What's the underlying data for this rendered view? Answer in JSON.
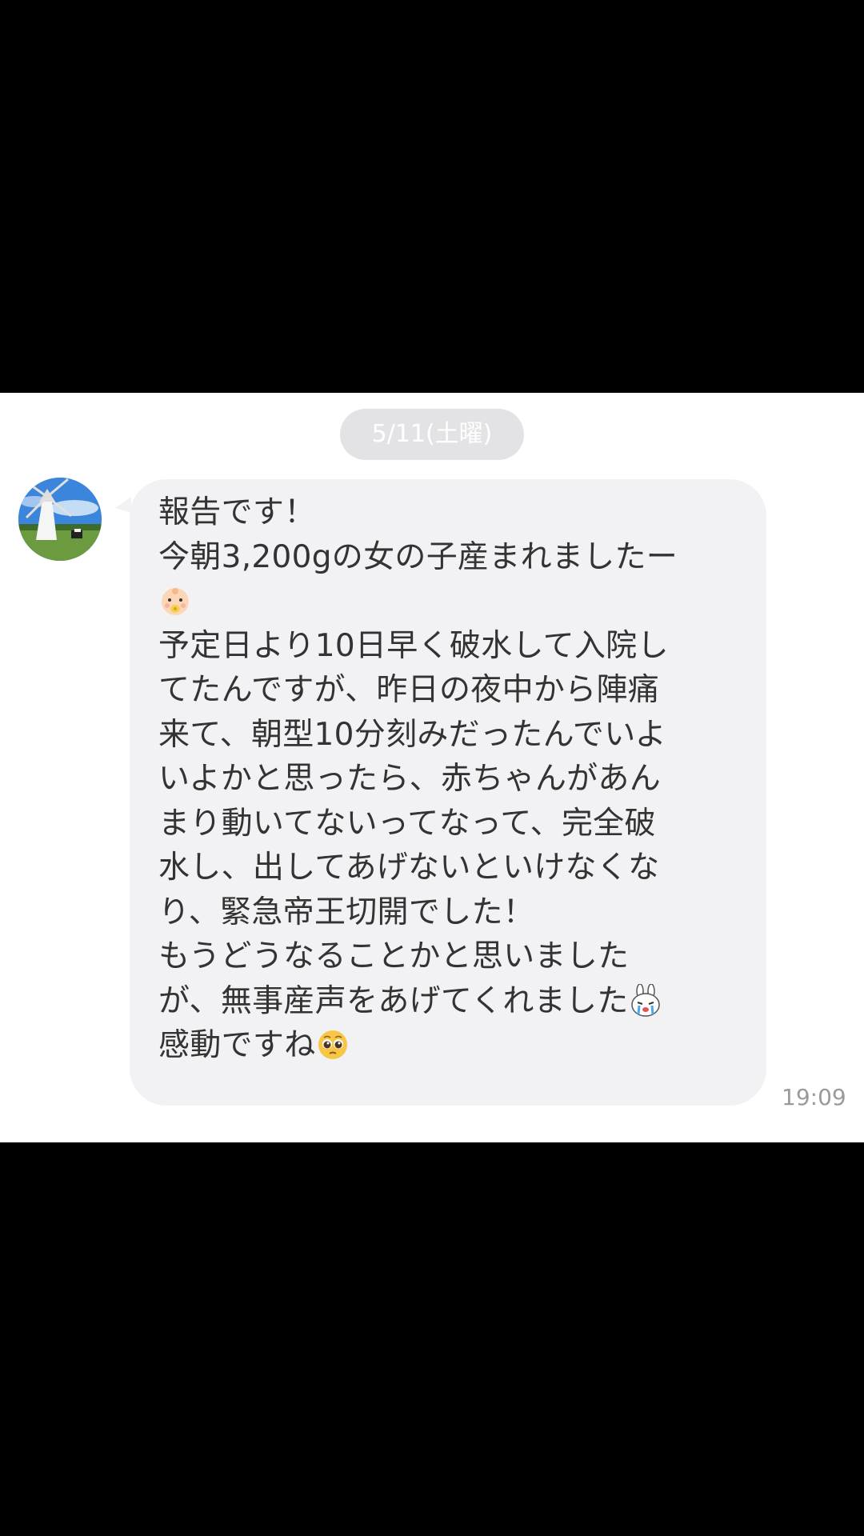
{
  "chat": {
    "date_separator": "5/11(土曜)",
    "message": {
      "lines": [
        "報告です！",
        "今朝3,200gの女の子産まれましたー",
        "",
        "予定日より10日早く破水して入院し",
        "てたんですが、昨日の夜中から陣痛",
        "来て、朝型10分刻みだったんでいよ",
        "いよかと思ったら、赤ちゃんがあん",
        "まり動いてないってなって、完全破",
        "水し、出してあげないといけなくな",
        "り、緊急帝王切開でした！",
        "もうどうなることかと思いました",
        "が、無事産声をあげてくれました",
        "感動ですね"
      ],
      "emojis": [
        "baby-emoji",
        "crying-bunny-emoji",
        "pleading-face-emoji"
      ],
      "time": "19:09"
    }
  },
  "colors": {
    "bubble": "#f2f2f5",
    "date_chip": "#e3e3e6",
    "text": "#333333",
    "timestamp": "#9a9a9a"
  }
}
